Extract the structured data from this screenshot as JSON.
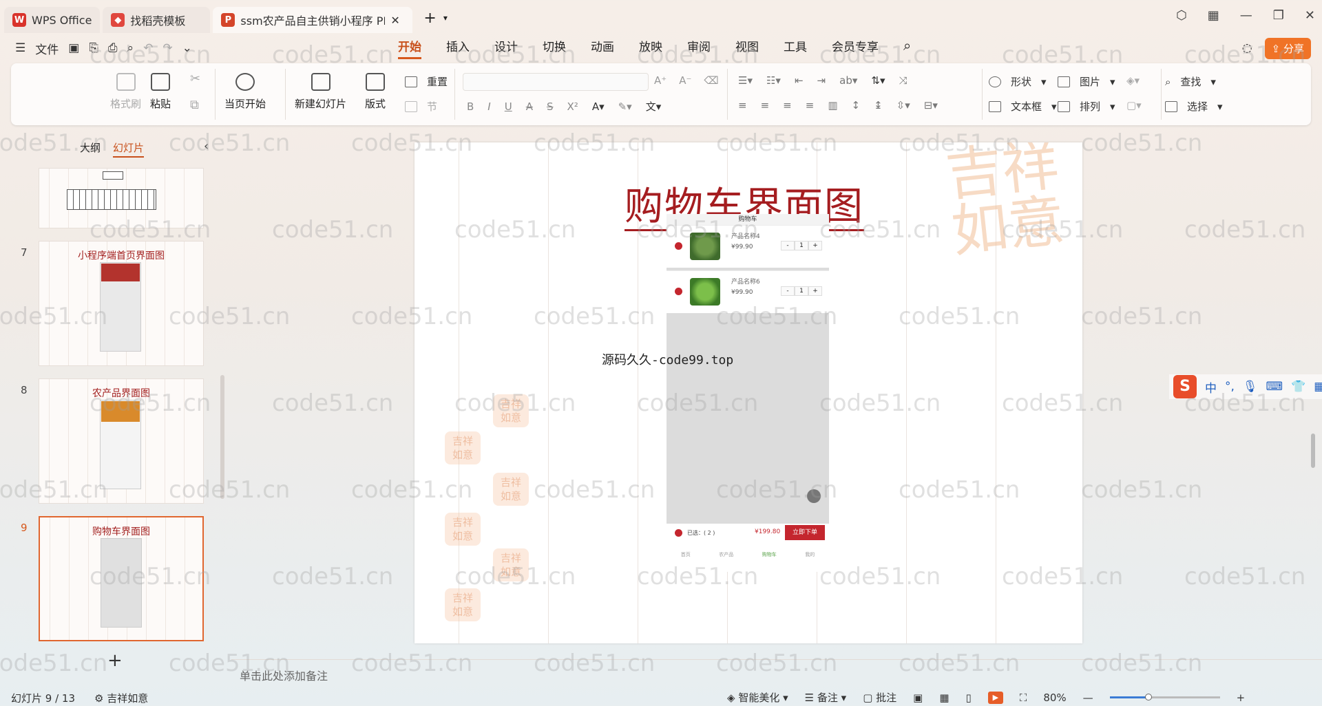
{
  "tabs": [
    {
      "label": "WPS Office",
      "logo": "W"
    },
    {
      "label": "找稻壳模板",
      "logo": "◆"
    },
    {
      "label": "ssm农产品自主供销小程序 PP",
      "logo": "P"
    }
  ],
  "menu": {
    "file_label": "文件",
    "tabs": [
      "开始",
      "插入",
      "设计",
      "切换",
      "动画",
      "放映",
      "审阅",
      "视图",
      "工具",
      "会员专享"
    ],
    "share_label": "分享"
  },
  "ribbon": {
    "format_painter": "格式刷",
    "paste": "粘贴",
    "start_current": "当页开始",
    "new_slide": "新建幻灯片",
    "layout": "版式",
    "reset": "重置",
    "section": "节",
    "shape": "形状",
    "picture": "图片",
    "textbox": "文本框",
    "arrange": "排列",
    "find": "查找",
    "select": "选择"
  },
  "pane": {
    "outline_tab": "大纲",
    "slides_tab": "幻灯片",
    "thumbnails": [
      {
        "num": "7",
        "title": "小程序端首页界面图"
      },
      {
        "num": "8",
        "title": "农产品界面图"
      },
      {
        "num": "9",
        "title": "购物车界面图"
      }
    ]
  },
  "slide": {
    "title": "购物车界面图",
    "seal_text": "吉祥如意",
    "caption": "源码久久-code99.top",
    "phone": {
      "header": "购物车",
      "items": [
        {
          "name": "产品名称4",
          "price": "¥99.90",
          "qty": "1",
          "minus": "-",
          "plus": "+"
        },
        {
          "name": "产品名称6",
          "price": "¥99.90",
          "qty": "1",
          "minus": "-",
          "plus": "+"
        }
      ],
      "selected_label": "已选：( 2 )",
      "total": "¥199.80",
      "order_button": "立即下单",
      "nav": [
        "首页",
        "农产品",
        "购物车",
        "我的"
      ]
    }
  },
  "notes_placeholder": "单击此处添加备注",
  "status": {
    "slide_counter": "幻灯片 9 / 13",
    "theme": "吉祥如意",
    "beautify": "智能美化",
    "notes": "备注",
    "comment": "批注",
    "zoom": "80%",
    "zoom_level": 0.35
  },
  "ime": {
    "lang": "中",
    "punct": "°,"
  },
  "watermark": "code51.cn",
  "colors": {
    "accent": "#d6571b",
    "title_red": "#a51d20",
    "share": "#f07326"
  }
}
